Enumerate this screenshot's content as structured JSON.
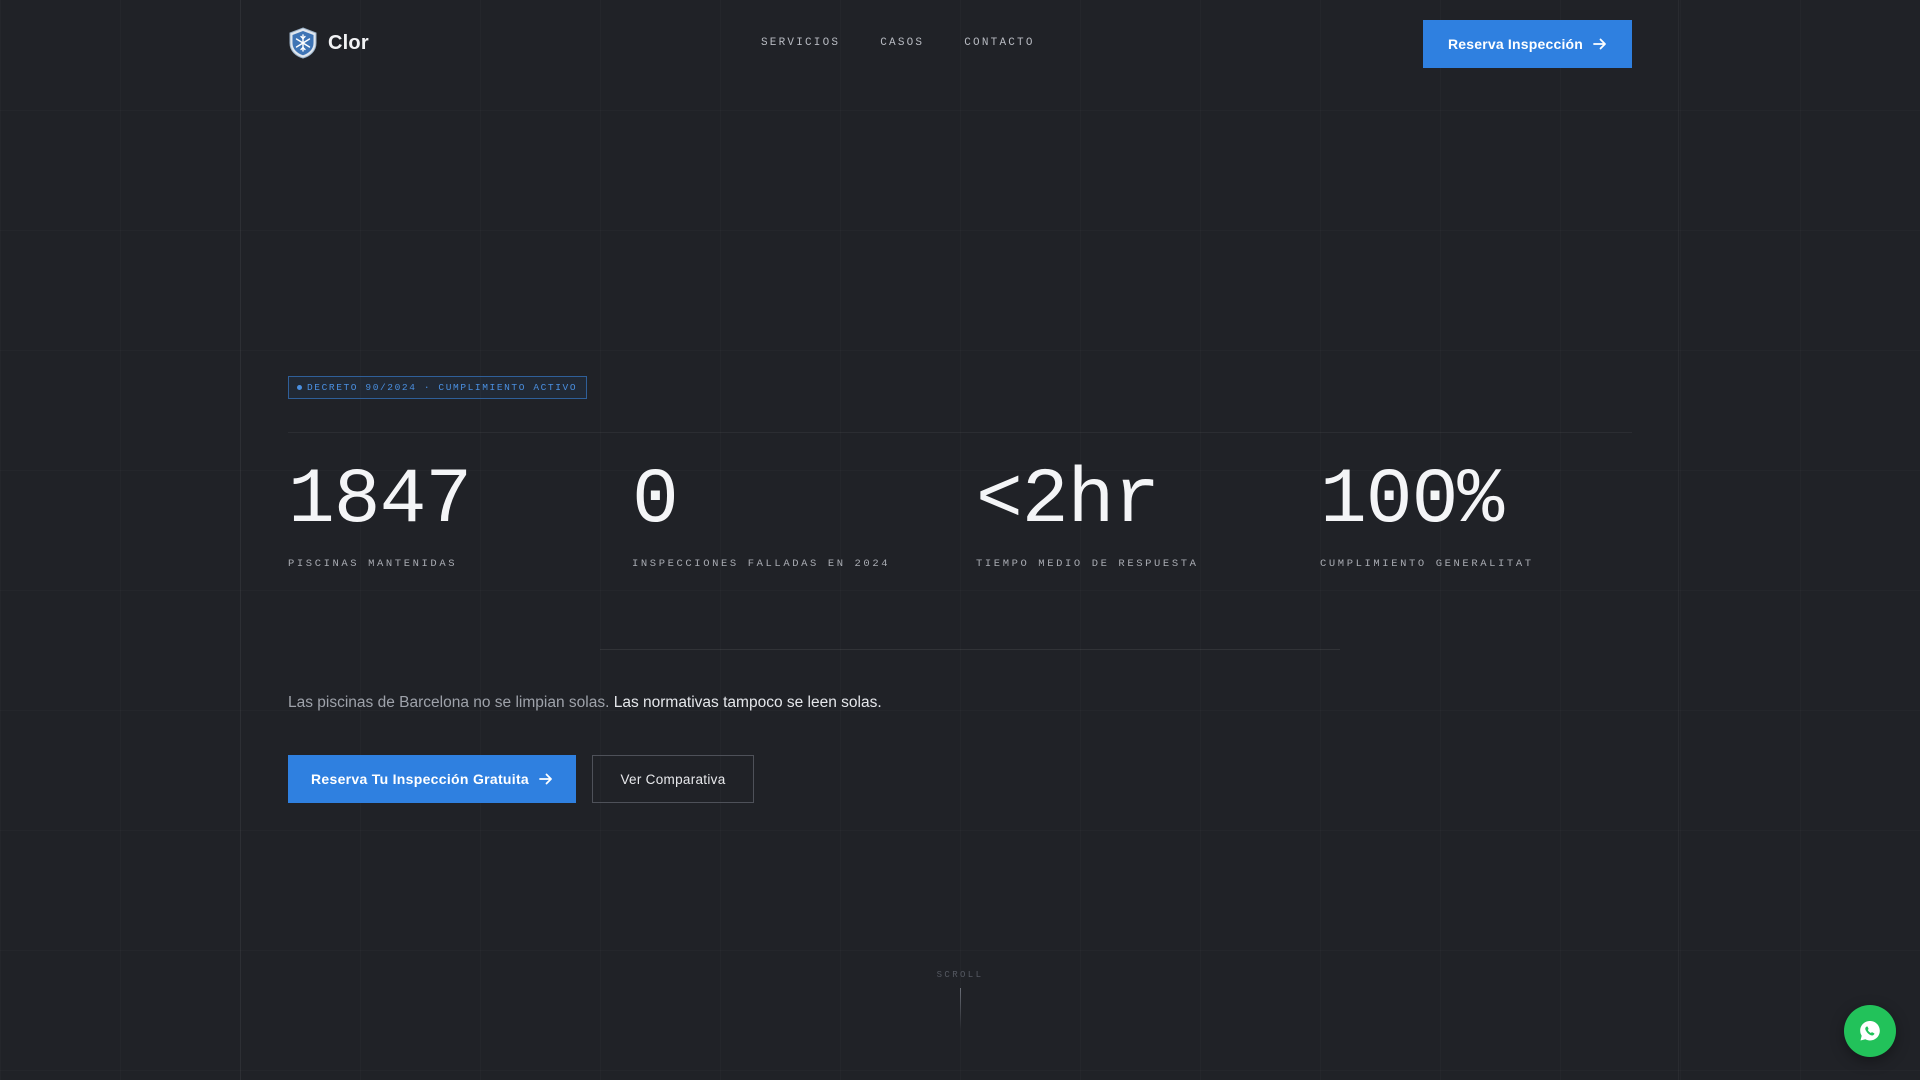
{
  "brand": {
    "name": "Clor",
    "logo_icon": "snowflake-shield-icon"
  },
  "nav": {
    "items": [
      {
        "label": "SERVICIOS"
      },
      {
        "label": "CASOS"
      },
      {
        "label": "CONTACTO"
      }
    ]
  },
  "header": {
    "cta_label": "Reserva Inspección",
    "cta_icon": "arrow-right-icon"
  },
  "badge": {
    "text": "DECRETO 90/2024 · CUMPLIMIENTO ACTIVO"
  },
  "stats": [
    {
      "value": "1847",
      "label": "PISCINAS MANTENIDAS"
    },
    {
      "value": "0",
      "label": "INSPECCIONES FALLADAS EN 2024"
    },
    {
      "value": "<2hr",
      "label": "TIEMPO MEDIO DE RESPUESTA"
    },
    {
      "value": "100%",
      "label": "CUMPLIMIENTO GENERALITAT"
    }
  ],
  "tagline": {
    "muted": "Las piscinas de Barcelona no se limpian solas.",
    "strong": "Las normativas tampoco se leen solas."
  },
  "hero": {
    "primary_label": "Reserva Tu Inspección Gratuita",
    "secondary_label": "Ver Comparativa"
  },
  "scroll": {
    "label": "SCROLL"
  },
  "floating": {
    "icon": "whatsapp-icon"
  },
  "colors": {
    "accent": "#2f80e0",
    "background": "#202227",
    "whatsapp": "#22c25a"
  }
}
